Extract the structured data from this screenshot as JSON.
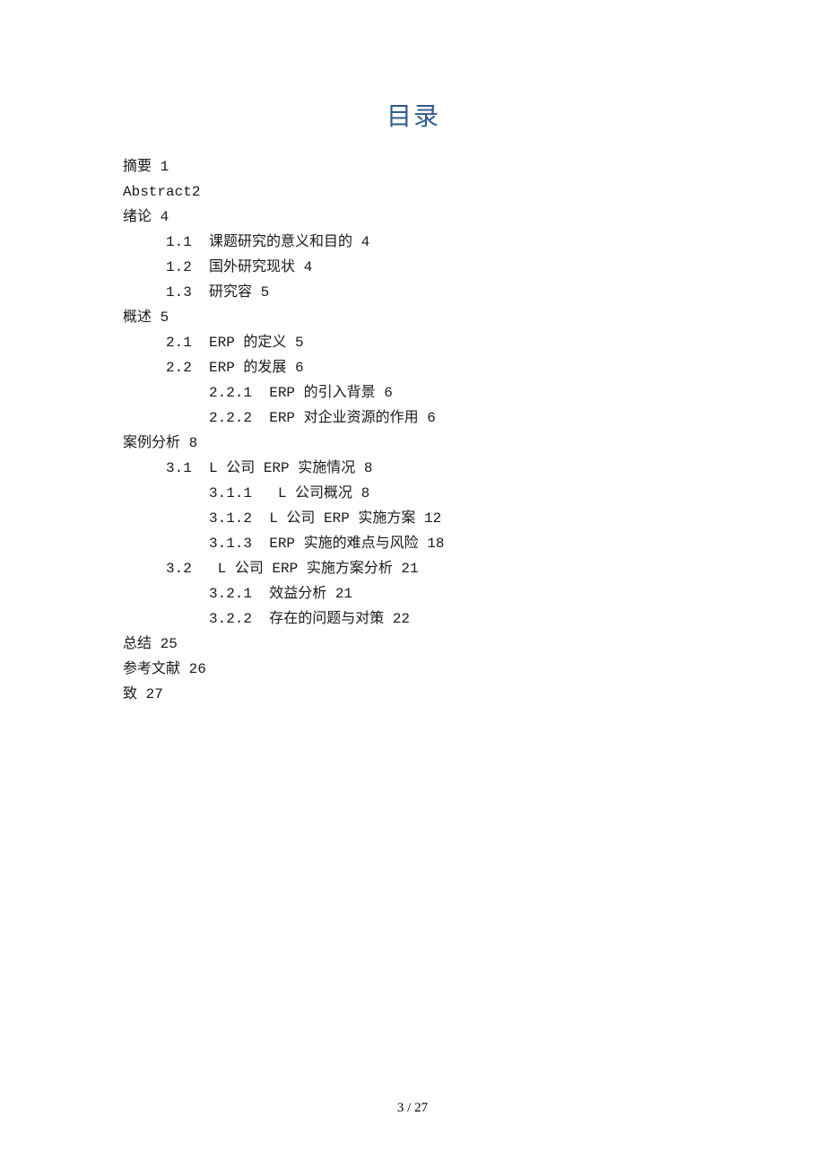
{
  "title": "目录",
  "entries": [
    {
      "level": 0,
      "text": "摘要 1"
    },
    {
      "level": 0,
      "text": "Abstract2"
    },
    {
      "level": 0,
      "text": "绪论 4"
    },
    {
      "level": 1,
      "text": "1.1  课题研究的意义和目的 4"
    },
    {
      "level": 1,
      "text": "1.2  国外研究现状 4"
    },
    {
      "level": 1,
      "text": "1.3  研究容 5"
    },
    {
      "level": 0,
      "text": "概述 5"
    },
    {
      "level": 1,
      "text": "2.1  ERP 的定义 5"
    },
    {
      "level": 1,
      "text": "2.2  ERP 的发展 6"
    },
    {
      "level": 2,
      "text": "2.2.1  ERP 的引入背景 6"
    },
    {
      "level": 2,
      "text": "2.2.2  ERP 对企业资源的作用 6"
    },
    {
      "level": 0,
      "text": "案例分析 8"
    },
    {
      "level": 1,
      "text": "3.1  L 公司 ERP 实施情况 8"
    },
    {
      "level": 2,
      "text": "3.1.1   L 公司概况 8"
    },
    {
      "level": 2,
      "text": "3.1.2  L 公司 ERP 实施方案 12"
    },
    {
      "level": 2,
      "text": "3.1.3  ERP 实施的难点与风险 18"
    },
    {
      "level": 1,
      "text": "3.2   L 公司 ERP 实施方案分析 21"
    },
    {
      "level": 2,
      "text": "3.2.1  效益分析 21"
    },
    {
      "level": 2,
      "text": "3.2.2  存在的问题与对策 22"
    },
    {
      "level": 0,
      "text": "总结 25"
    },
    {
      "level": 0,
      "text": "参考文献 26"
    },
    {
      "level": 0,
      "text": "致 27"
    }
  ],
  "footer": "3 / 27"
}
